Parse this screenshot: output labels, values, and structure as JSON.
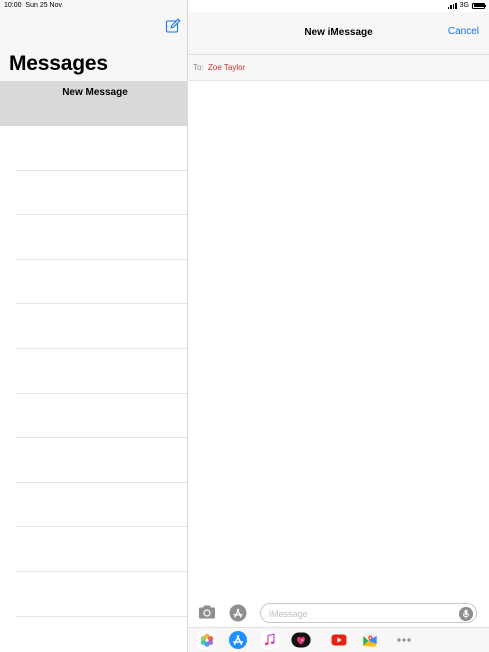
{
  "status_bar": {
    "time": "10:00",
    "date": "Sun 25 Nov",
    "network": "3G"
  },
  "sidebar": {
    "title": "Messages",
    "compose_icon": "compose-icon",
    "selected_item": "New Message",
    "empty_rows": 11
  },
  "conversation": {
    "title": "New iMessage",
    "cancel_label": "Cancel",
    "to_label": "To:",
    "recipient": "Zoe Taylor"
  },
  "input_bar": {
    "placeholder": "iMessage",
    "camera_icon": "camera-icon",
    "apps_icon": "app-store-icon",
    "mic_icon": "microphone-icon"
  },
  "app_drawer": {
    "apps": [
      "photos-icon",
      "app-store-icon",
      "music-icon",
      "digital-touch-icon",
      "youtube-icon",
      "maps-icon",
      "more-icon"
    ]
  },
  "colors": {
    "accent": "#1a73e8",
    "recipient": "#d0312d",
    "selected_row": "#d9d9d9",
    "bar_background": "#f7f7f7"
  }
}
